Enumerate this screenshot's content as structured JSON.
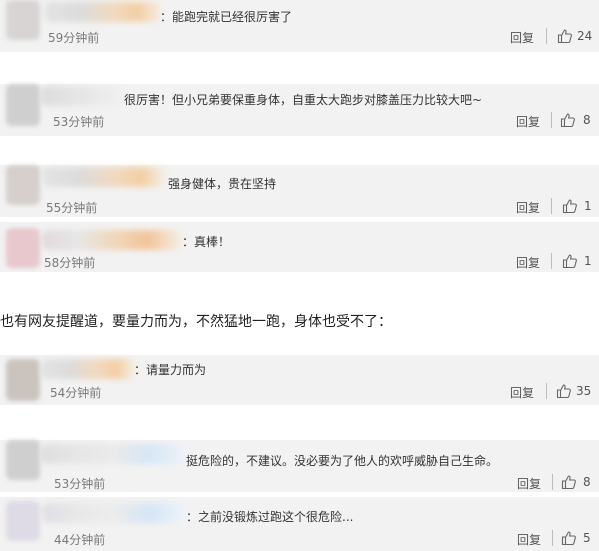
{
  "group1": [
    {
      "content": "：能跑完就已经很厉害了",
      "time": "59分钟前",
      "reply": "回复",
      "likes": "24"
    },
    {
      "content": "很厉害！但小兄弟要保重身体，自重太大跑步对膝盖压力比较大吧~",
      "time": "53分钟前",
      "reply": "回复",
      "likes": "8"
    },
    {
      "content": "强身健体，贵在坚持",
      "time": "55分钟前",
      "reply": "回复",
      "likes": "1"
    },
    {
      "content": "：真棒！",
      "time": "58分钟前",
      "reply": "回复",
      "likes": "1"
    }
  ],
  "caption": "也有网友提醒道，要量力而为，不然猛地一跑，身体也受不了：",
  "group2": [
    {
      "content": "：请量力而为",
      "time": "54分钟前",
      "reply": "回复",
      "likes": "35"
    },
    {
      "content": "挺危险的，不建议。没必要为了他人的欢呼威胁自己生命。",
      "time": "53分钟前",
      "reply": "回复",
      "likes": "8"
    },
    {
      "content": "：之前没锻炼过跑这个很危险...",
      "time": "44分钟前",
      "reply": "回复",
      "likes": "5"
    }
  ],
  "icons": {
    "thumb": "thumbs-up-icon"
  },
  "colors": {
    "card_bg": "#f2f2f2",
    "text": "#333333",
    "meta": "#7a7a7a"
  }
}
